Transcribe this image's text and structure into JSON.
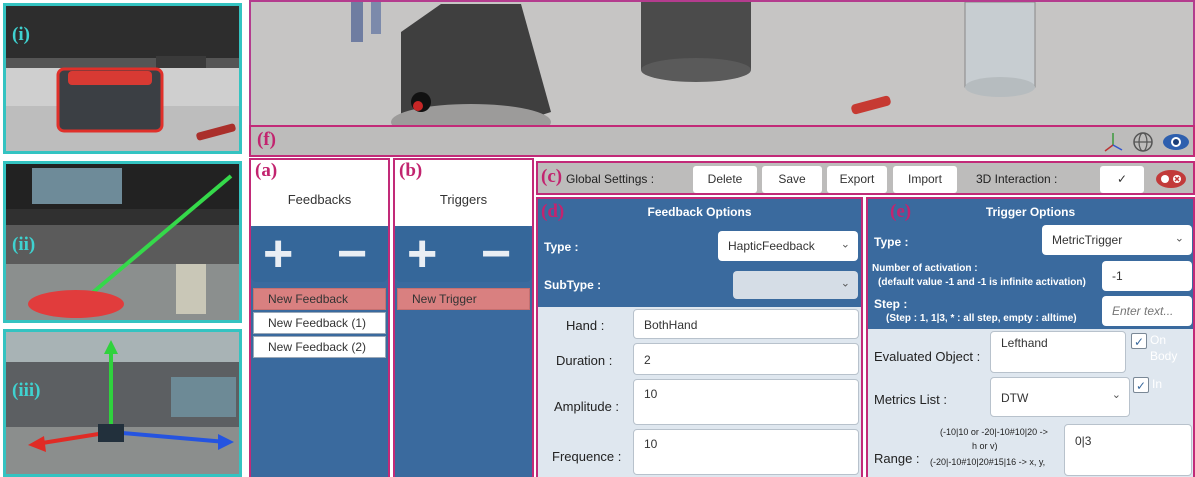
{
  "thumbnails": [
    {
      "tag": "(i)"
    },
    {
      "tag": "(ii)"
    },
    {
      "tag": "(iii)"
    }
  ],
  "panel_tags": {
    "a": "(a)",
    "b": "(b)",
    "c": "(c)",
    "d": "(d)",
    "e": "(e)",
    "f": "(f)"
  },
  "feedbacks": {
    "title": "Feedbacks",
    "items": [
      "New Feedback",
      "New Feedback (1)",
      "New Feedback (2)"
    ]
  },
  "triggers": {
    "title": "Triggers",
    "items": [
      "New Trigger"
    ]
  },
  "global_settings": {
    "label": "Global Settings :",
    "delete": "Delete",
    "save": "Save",
    "export": "Export",
    "import": "Import",
    "interaction_label": "3D Interaction :",
    "interaction_check": "✓"
  },
  "feedback_options": {
    "title": "Feedback Options",
    "type_label": "Type :",
    "type_value": "HapticFeedback",
    "subtype_label": "SubType :",
    "subtype_value": "",
    "hand_label": "Hand :",
    "hand_value": "BothHand",
    "duration_label": "Duration :",
    "duration_value": "2",
    "amplitude_label": "Amplitude :",
    "amplitude_value": "10",
    "frequence_label": "Frequence :",
    "frequence_value": "10"
  },
  "trigger_options": {
    "title": "Trigger Options",
    "type_label": "Type :",
    "type_value": "MetricTrigger",
    "activation_label": "Number of activation :",
    "activation_hint": "(default value -1 and -1 is infinite activation)",
    "activation_value": "-1",
    "step_label": "Step :",
    "step_hint": "(Step : 1, 1|3, * : all step, empty : alltime)",
    "step_placeholder": "Enter text...",
    "evaluated_label": "Evaluated Object :",
    "evaluated_value": "Lefthand",
    "on_body_label1": "On",
    "on_body_label2": "Body",
    "metrics_label": "Metrics List :",
    "metrics_value": "DTW",
    "in_label": "In",
    "range_label": "Range :",
    "range_hint1": "(-10|10 or -20|-10#10|20 ->",
    "range_hint2": "h or v)",
    "range_hint3": "(-20|-10#10|20#15|16 -> x, y,",
    "range_value": "0|3",
    "check": "✓"
  },
  "colors": {
    "panel_blue": "#3a6a9e",
    "frame_pink": "#c22a78",
    "thumb_teal": "#34c3c1",
    "selected_row": "#d98080"
  }
}
